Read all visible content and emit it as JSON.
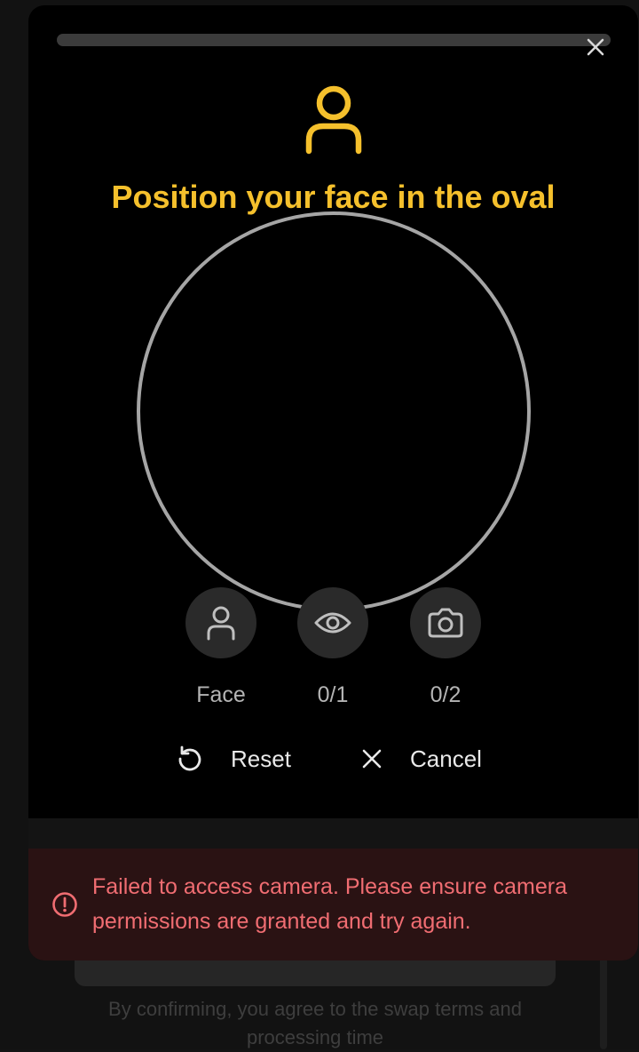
{
  "background": {
    "footer_text": "By confirming, you agree to the swap terms and processing time"
  },
  "modal": {
    "title": "Position your face in the oval",
    "close_icon": "close-icon",
    "steps": [
      {
        "icon": "person-icon",
        "label": "Face"
      },
      {
        "icon": "eye-icon",
        "label": "0/1"
      },
      {
        "icon": "camera-icon",
        "label": "0/2"
      }
    ],
    "actions": {
      "reset_label": "Reset",
      "cancel_label": "Cancel"
    }
  },
  "error": {
    "icon": "alert-circle-icon",
    "message": "Failed to access camera. Please ensure camera permissions are granted and try again."
  },
  "colors": {
    "accent": "#f5c02c",
    "error_text": "#f06d72",
    "error_bg": "#2a1213",
    "oval_border": "#a5a5a5"
  }
}
